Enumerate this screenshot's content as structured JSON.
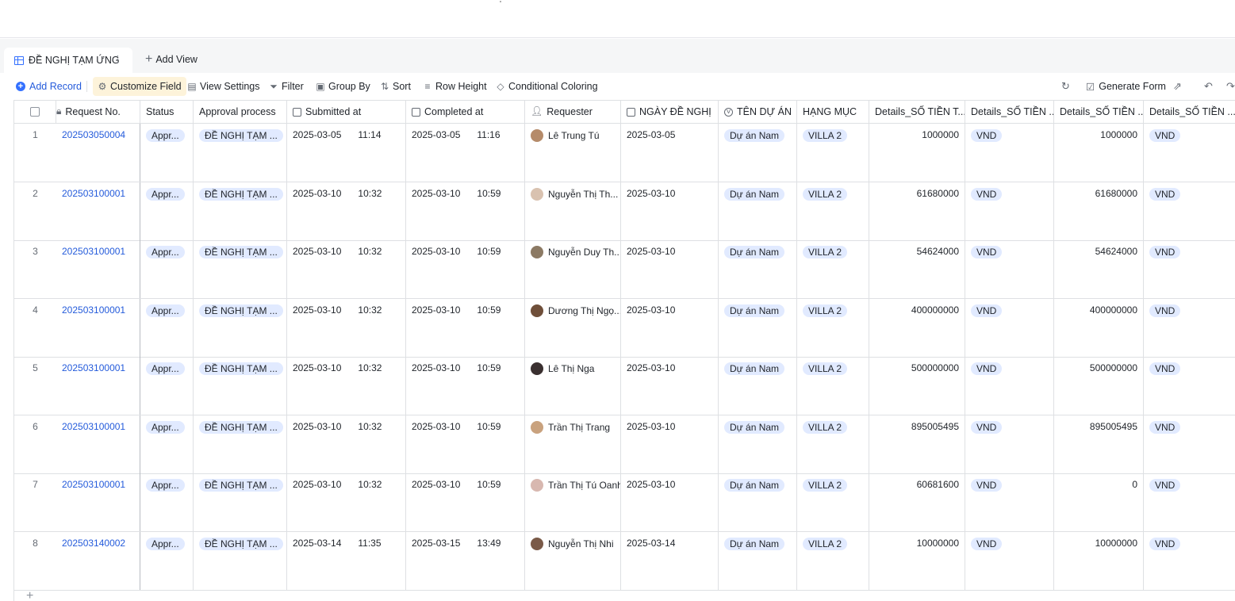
{
  "view_tab": {
    "label": "ĐỀ NGHỊ TẠM ỨNG",
    "add_view": "Add View"
  },
  "toolbar": {
    "add_record": "Add Record",
    "customize_field": "Customize Field",
    "view_settings": "View Settings",
    "filter": "Filter",
    "group_by": "Group By",
    "sort": "Sort",
    "row_height": "Row Height",
    "conditional_coloring": "Conditional Coloring",
    "generate_form": "Generate Form"
  },
  "columns": [
    {
      "key": "request_no",
      "label": "Request No."
    },
    {
      "key": "status",
      "label": "Status"
    },
    {
      "key": "approval",
      "label": "Approval process"
    },
    {
      "key": "submitted",
      "label": "Submitted at"
    },
    {
      "key": "completed",
      "label": "Completed at"
    },
    {
      "key": "requester",
      "label": "Requester"
    },
    {
      "key": "ngay",
      "label": "NGÀY ĐỀ NGHỊ"
    },
    {
      "key": "ten_du_an",
      "label": "TÊN DỰ ÁN"
    },
    {
      "key": "hang_muc",
      "label": "HẠNG MỤC"
    },
    {
      "key": "so_tien_1",
      "label": "Details_SỐ TIỀN T..."
    },
    {
      "key": "so_tien_2",
      "label": "Details_SỐ TIỀN ..."
    },
    {
      "key": "so_tien_3",
      "label": "Details_SỐ TIỀN ..."
    },
    {
      "key": "so_tien_4",
      "label": "Details_SỐ TIỀN ..."
    }
  ],
  "rows": [
    {
      "index": "1",
      "request_no": "202503050004",
      "status": "Appr...",
      "approval": "ĐỀ NGHỊ TẠM ...",
      "submitted_date": "2025-03-05",
      "submitted_time": "11:14",
      "completed_date": "2025-03-05",
      "completed_time": "11:16",
      "requester": "Lê Trung Tú",
      "ngay": "2025-03-05",
      "du_an": "Dự án Nam",
      "hang_muc": "VILLA 2",
      "amount_1": "1000000",
      "currency_1": "VND",
      "amount_2": "1000000",
      "currency_2": "VND"
    },
    {
      "index": "2",
      "request_no": "202503100001",
      "status": "Appr...",
      "approval": "ĐỀ NGHỊ TẠM ...",
      "submitted_date": "2025-03-10",
      "submitted_time": "10:32",
      "completed_date": "2025-03-10",
      "completed_time": "10:59",
      "requester": "Nguyễn Thị Th...",
      "ngay": "2025-03-10",
      "du_an": "Dự án Nam",
      "hang_muc": "VILLA 2",
      "amount_1": "61680000",
      "currency_1": "VND",
      "amount_2": "61680000",
      "currency_2": "VND"
    },
    {
      "index": "3",
      "request_no": "202503100001",
      "status": "Appr...",
      "approval": "ĐỀ NGHỊ TẠM ...",
      "submitted_date": "2025-03-10",
      "submitted_time": "10:32",
      "completed_date": "2025-03-10",
      "completed_time": "10:59",
      "requester": "Nguyễn Duy Th...",
      "ngay": "2025-03-10",
      "du_an": "Dự án Nam",
      "hang_muc": "VILLA 2",
      "amount_1": "54624000",
      "currency_1": "VND",
      "amount_2": "54624000",
      "currency_2": "VND"
    },
    {
      "index": "4",
      "request_no": "202503100001",
      "status": "Appr...",
      "approval": "ĐỀ NGHỊ TẠM ...",
      "submitted_date": "2025-03-10",
      "submitted_time": "10:32",
      "completed_date": "2025-03-10",
      "completed_time": "10:59",
      "requester": "Dương Thị Ngọ...",
      "ngay": "2025-03-10",
      "du_an": "Dự án Nam",
      "hang_muc": "VILLA 2",
      "amount_1": "400000000",
      "currency_1": "VND",
      "amount_2": "400000000",
      "currency_2": "VND"
    },
    {
      "index": "5",
      "request_no": "202503100001",
      "status": "Appr...",
      "approval": "ĐỀ NGHỊ TẠM ...",
      "submitted_date": "2025-03-10",
      "submitted_time": "10:32",
      "completed_date": "2025-03-10",
      "completed_time": "10:59",
      "requester": "Lê Thị Nga",
      "ngay": "2025-03-10",
      "du_an": "Dự án Nam",
      "hang_muc": "VILLA 2",
      "amount_1": "500000000",
      "currency_1": "VND",
      "amount_2": "500000000",
      "currency_2": "VND"
    },
    {
      "index": "6",
      "request_no": "202503100001",
      "status": "Appr...",
      "approval": "ĐỀ NGHỊ TẠM ...",
      "submitted_date": "2025-03-10",
      "submitted_time": "10:32",
      "completed_date": "2025-03-10",
      "completed_time": "10:59",
      "requester": "Trần Thị Trang",
      "ngay": "2025-03-10",
      "du_an": "Dự án Nam",
      "hang_muc": "VILLA 2",
      "amount_1": "895005495",
      "currency_1": "VND",
      "amount_2": "895005495",
      "currency_2": "VND"
    },
    {
      "index": "7",
      "request_no": "202503100001",
      "status": "Appr...",
      "approval": "ĐỀ NGHỊ TẠM ...",
      "submitted_date": "2025-03-10",
      "submitted_time": "10:32",
      "completed_date": "2025-03-10",
      "completed_time": "10:59",
      "requester": "Trần Thị Tú Oanh",
      "ngay": "2025-03-10",
      "du_an": "Dự án Nam",
      "hang_muc": "VILLA 2",
      "amount_1": "60681600",
      "currency_1": "VND",
      "amount_2": "0",
      "currency_2": "VND"
    },
    {
      "index": "8",
      "request_no": "202503140002",
      "status": "Appr...",
      "approval": "ĐỀ NGHỊ TẠM ...",
      "submitted_date": "2025-03-14",
      "submitted_time": "11:35",
      "completed_date": "2025-03-15",
      "completed_time": "13:49",
      "requester": "Nguyễn Thị  Nhi",
      "ngay": "2025-03-14",
      "du_an": "Dự án Nam",
      "hang_muc": "VILLA 2",
      "amount_1": "10000000",
      "currency_1": "VND",
      "amount_2": "10000000",
      "currency_2": "VND"
    }
  ],
  "colors": {
    "accent": "#3370ff",
    "link": "#245bdb",
    "pill_bg": "#e1eaff",
    "highlight_bg": "#fdf3da",
    "border": "#dee0e3"
  },
  "icons": [
    "grid-view-icon",
    "more-icon",
    "plus-icon",
    "add-circle-icon",
    "gear-icon",
    "view-settings-icon",
    "filter-icon",
    "group-icon",
    "sort-icon",
    "row-height-icon",
    "paint-icon",
    "history-icon",
    "form-icon",
    "share-icon",
    "undo-icon",
    "redo-icon",
    "lock-icon",
    "calendar-icon",
    "person-icon",
    "option-icon"
  ]
}
